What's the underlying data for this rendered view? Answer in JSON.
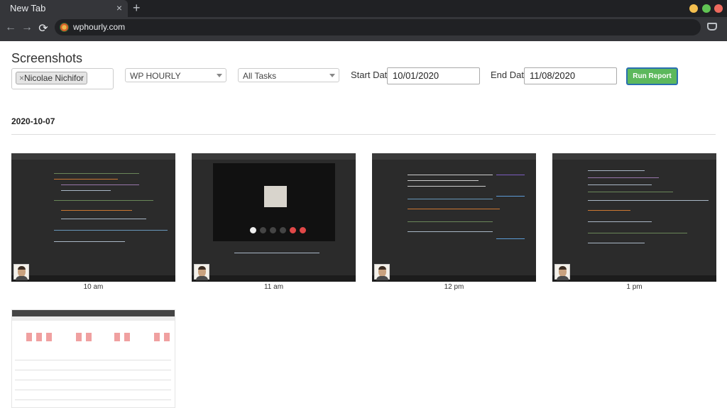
{
  "browser": {
    "tab_title": "New Tab",
    "tab_close": "×",
    "new_tab": "+",
    "url": "wphourly.com",
    "back": "←",
    "forward": "→",
    "reload": "⟳",
    "window_colors": {
      "minimize": "#f5bf4f",
      "maximize": "#61c454",
      "close": "#ed6a5e"
    }
  },
  "page": {
    "title": "Screenshots",
    "filters": {
      "user_tag_remove": "×",
      "user_tag": "Nicolae Nichifor",
      "project": "WP HOURLY",
      "task": "All Tasks",
      "start_date_label": "Start Date",
      "start_date": "10/01/2020",
      "end_date_label": "End Date",
      "end_date": "11/08/2020",
      "run_button": "Run Report"
    },
    "day": "2020-10-07",
    "screenshots": [
      {
        "time": "10 am",
        "icon": "ide-code-screenshot"
      },
      {
        "time": "11 am",
        "icon": "video-call-screenshot"
      },
      {
        "time": "12 pm",
        "icon": "forum-page-screenshot"
      },
      {
        "time": "1 pm",
        "icon": "ide-code-screenshot"
      },
      {
        "time": "",
        "icon": "report-page-screenshot"
      }
    ]
  }
}
